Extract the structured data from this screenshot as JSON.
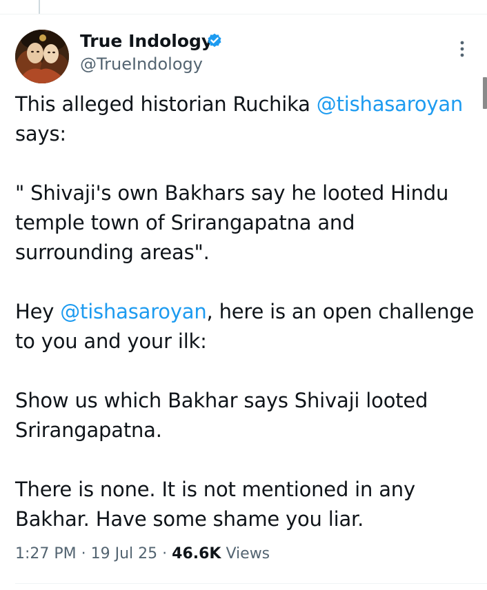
{
  "author": {
    "display_name": "True Indology",
    "handle": "@TrueIndology",
    "verified": true,
    "verified_color": "#1d9bf0"
  },
  "tweet": {
    "p1_text": "This alleged historian Ruchika ",
    "p1_mention": "@tishasaroyan",
    "p1_tail": " says:",
    "p2_text": "\" Shivaji's own Bakhars say he looted Hindu temple town of Srirangapatna and surrounding areas\".",
    "p3_head": "Hey ",
    "p3_mention": "@tishasaroyan",
    "p3_tail": ", here is an open challenge to you and your ilk:",
    "p4_text": "Show us which Bakhar says Shivaji looted Srirangapatna.",
    "p5_text": "There is none. It is not mentioned in any Bakhar. Have some shame you liar."
  },
  "meta": {
    "time": "1:27 PM",
    "separator": " · ",
    "date": "19 Jul 25",
    "views_count": "46.6K",
    "views_label": " Views"
  },
  "colors": {
    "text": "#0f1419",
    "secondary": "#536471",
    "link": "#1d9bf0",
    "divider": "#eff3f4"
  },
  "icons": {
    "more": "more-vertical-icon",
    "verified": "verified-badge-icon"
  }
}
